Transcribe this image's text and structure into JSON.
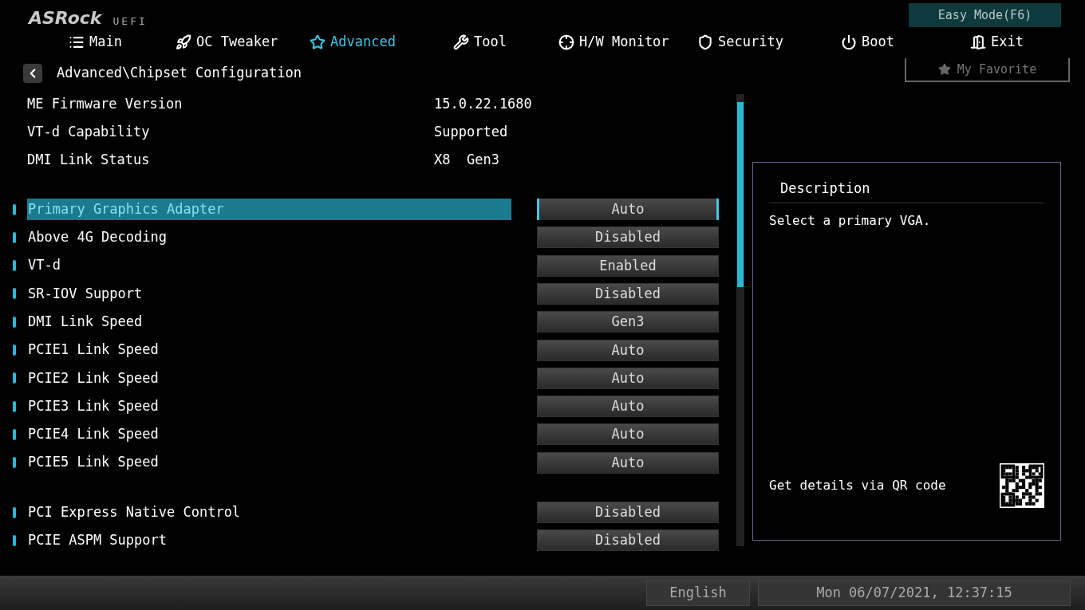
{
  "brand": {
    "logo": "ASRock",
    "suffix": "UEFI"
  },
  "easy_mode": {
    "label": "Easy Mode(F6)"
  },
  "tabs": [
    {
      "label": "Main",
      "selected": false
    },
    {
      "label": "OC Tweaker",
      "selected": false
    },
    {
      "label": "Advanced",
      "selected": true
    },
    {
      "label": "Tool",
      "selected": false
    },
    {
      "label": "H/W Monitor",
      "selected": false
    },
    {
      "label": "Security",
      "selected": false
    },
    {
      "label": "Boot",
      "selected": false
    },
    {
      "label": "Exit",
      "selected": false
    }
  ],
  "favorite": {
    "label": "My Favorite"
  },
  "breadcrumb": "Advanced\\Chipset Configuration",
  "info": [
    {
      "label": "ME Firmware Version",
      "value": "15.0.22.1680"
    },
    {
      "label": "VT-d Capability",
      "value": "Supported"
    },
    {
      "label": "DMI Link Status",
      "value": "X8  Gen3"
    }
  ],
  "setting_groups": [
    [
      {
        "label": "Primary Graphics Adapter",
        "value": "Auto",
        "selected": true
      },
      {
        "label": "Above 4G Decoding",
        "value": "Disabled",
        "selected": false
      },
      {
        "label": "VT-d",
        "value": "Enabled",
        "selected": false
      },
      {
        "label": "SR-IOV Support",
        "value": "Disabled",
        "selected": false
      },
      {
        "label": "DMI Link Speed",
        "value": "Gen3",
        "selected": false
      },
      {
        "label": "PCIE1 Link Speed",
        "value": "Auto",
        "selected": false
      },
      {
        "label": "PCIE2 Link Speed",
        "value": "Auto",
        "selected": false
      },
      {
        "label": "PCIE3 Link Speed",
        "value": "Auto",
        "selected": false
      },
      {
        "label": "PCIE4 Link Speed",
        "value": "Auto",
        "selected": false
      },
      {
        "label": "PCIE5 Link Speed",
        "value": "Auto",
        "selected": false
      }
    ],
    [
      {
        "label": "PCI Express Native Control",
        "value": "Disabled",
        "selected": false
      },
      {
        "label": "PCIE ASPM Support",
        "value": "Disabled",
        "selected": false
      }
    ]
  ],
  "description": {
    "title": "Description",
    "text": "Select a primary VGA.",
    "qr_hint": "Get details via QR code"
  },
  "status_bar": {
    "language": "English",
    "datetime": "Mon 06/07/2021, 12:37:15"
  }
}
